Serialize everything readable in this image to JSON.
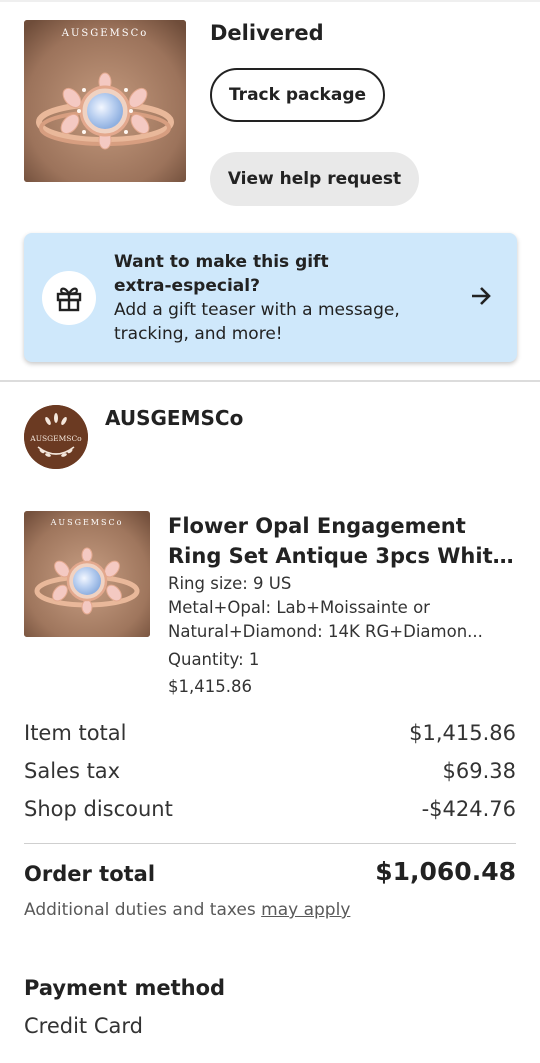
{
  "order": {
    "status": "Delivered",
    "track_label": "Track package",
    "help_label": "View help request",
    "thumb_watermark": "AUSGEMSCo"
  },
  "gift": {
    "title_line1": "Want to make this gift",
    "title_line2": "extra-especial?",
    "body_line1": "Add a gift teaser with a message,",
    "body_line2": "tracking, and more!",
    "icon": "gift-icon",
    "arrow_icon": "arrow-right-icon"
  },
  "shop": {
    "name": "AUSGEMSCo",
    "avatar_text": "AUSGEMSCo"
  },
  "item": {
    "title_line1": "Flower Opal Engagement",
    "title_line2": "Ring Set Antique 3pcs Whit...",
    "ring_size": "Ring size: 9 US",
    "metal_line1": "Metal+Opal: Lab+Moissainte or",
    "metal_line2": "Natural+Diamond: 14K RG+Diamon...",
    "quantity": "Quantity: 1",
    "price": "$1,415.86",
    "thumb_watermark": "AUSGEMSCo"
  },
  "totals": {
    "item_total_label": "Item total",
    "item_total_value": "$1,415.86",
    "sales_tax_label": "Sales tax",
    "sales_tax_value": "$69.38",
    "discount_label": "Shop discount",
    "discount_value": "-$424.76",
    "order_total_label": "Order total",
    "order_total_value": "$1,060.48",
    "duties_text": "Additional duties and taxes ",
    "duties_link": "may apply"
  },
  "payment": {
    "title": "Payment method",
    "method": "Credit Card"
  },
  "colors": {
    "banner_bg": "#cfe8fb",
    "button_gray": "#e9e9e9",
    "avatar_brown": "#6b3a22",
    "text": "#222222"
  }
}
